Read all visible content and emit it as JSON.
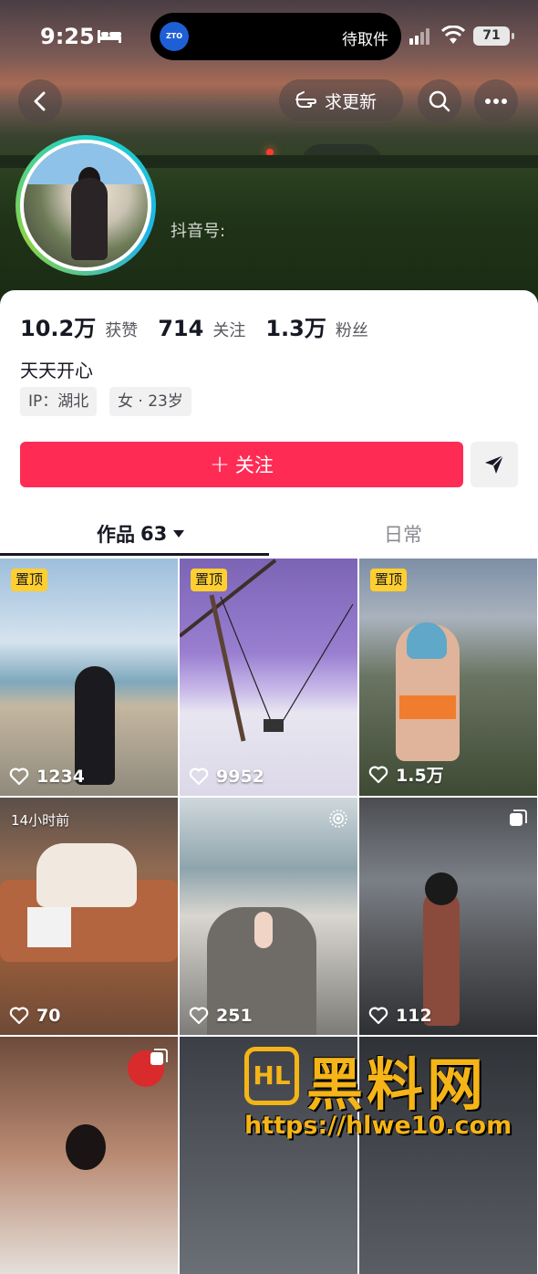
{
  "status_bar": {
    "time": "9:25",
    "island_text": "待取件",
    "island_app_badge": "ZTO",
    "battery": "71"
  },
  "header": {
    "request_update_label": "求更新",
    "douyin_id_label": "抖音号:"
  },
  "profile": {
    "likes_count": "10.2万",
    "likes_label": "获赞",
    "following_count": "714",
    "following_label": "关注",
    "followers_count": "1.3万",
    "followers_label": "粉丝",
    "bio": "天天开心",
    "tags": [
      "IP：湖北",
      "女 · 23岁"
    ],
    "follow_button": "关注",
    "follow_plus": "+"
  },
  "tabs": {
    "works_label": "作品",
    "works_count": "63",
    "daily_label": "日常"
  },
  "videos": [
    {
      "likes": "1234",
      "pinned": "置顶"
    },
    {
      "likes": "9952",
      "pinned": "置顶"
    },
    {
      "likes": "1.5万",
      "pinned": "置顶"
    },
    {
      "likes": "70",
      "time_badge": "14小时前"
    },
    {
      "likes": "251",
      "corner": "live-photo-icon"
    },
    {
      "likes": "112",
      "corner": "multi-image-icon"
    },
    {
      "corner": "multi-image-icon"
    },
    {},
    {}
  ],
  "watermark": {
    "logo_text": "HL",
    "title": "黑料网",
    "url": "https://hlwe10.com"
  },
  "colors": {
    "follow_red": "#fe2c55",
    "pin_yellow": "#fecf2f",
    "watermark_gold": "#f5b417"
  }
}
